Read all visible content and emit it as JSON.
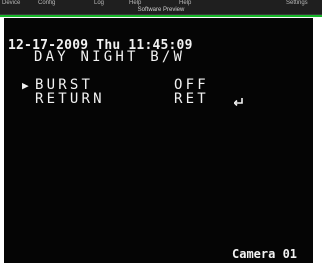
{
  "menu": {
    "items": [
      "Device",
      "Config",
      "Log",
      "Help",
      "Help",
      "Settings"
    ]
  },
  "preview": {
    "title": "Software Preview"
  },
  "osd": {
    "datetime": "12-17-2009 Thu 11:45:09",
    "mode": "DAY NIGHT B/W",
    "selector": "▶",
    "burst_label": "BURST",
    "burst_value": "OFF",
    "return_label": "RETURN",
    "return_value": "RET",
    "return_icon": "return-arrow-icon",
    "camera_label": "Camera 01"
  },
  "colors": {
    "accent_green": "#15b829",
    "osd_text": "#f2f2f2",
    "video_bg": "#050505"
  }
}
